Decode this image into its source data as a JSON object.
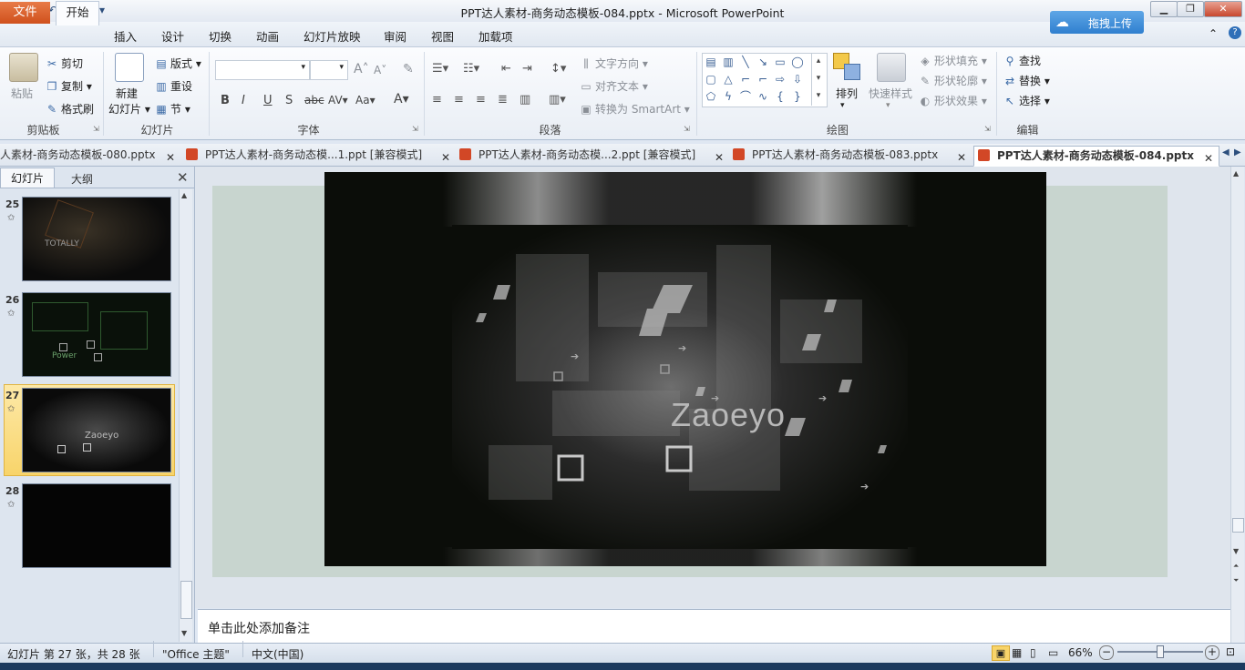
{
  "window": {
    "title": "PPT达人素材-商务动态模板-084.pptx - Microsoft PowerPoint",
    "app_icon": "P",
    "upload_button": "拖拽上传"
  },
  "menu": {
    "file": "文件",
    "tabs": [
      "开始",
      "插入",
      "设计",
      "切换",
      "动画",
      "幻灯片放映",
      "审阅",
      "视图",
      "加载项"
    ]
  },
  "ribbon": {
    "clipboard": {
      "paste": "粘贴",
      "cut": "剪切",
      "copy": "复制",
      "format_painter": "格式刷",
      "label": "剪贴板"
    },
    "slides": {
      "new_slide_line1": "新建",
      "new_slide_line2": "幻灯片",
      "layout": "版式",
      "reset": "重设",
      "section": "节",
      "label": "幻灯片"
    },
    "font": {
      "label": "字体",
      "buttons": [
        "B",
        "I",
        "U",
        "S",
        "abc",
        "AV",
        "Aa",
        "A"
      ],
      "grow": "A",
      "shrink": "A"
    },
    "paragraph": {
      "text_direction": "文字方向",
      "align_text": "对齐文本",
      "smartart": "转换为 SmartArt",
      "label": "段落"
    },
    "drawing": {
      "arrange": "排列",
      "quick_styles": "快速样式",
      "shape_fill": "形状填充",
      "shape_outline": "形状轮廓",
      "shape_effects": "形状效果",
      "label": "绘图"
    },
    "editing": {
      "find": "查找",
      "replace": "替换",
      "select": "选择",
      "label": "编辑"
    }
  },
  "doc_tabs": [
    {
      "label": "人素材-商务动态模板-080.pptx",
      "active": false
    },
    {
      "label": "PPT达人素材-商务动态模...1.ppt [兼容模式]",
      "active": false
    },
    {
      "label": "PPT达人素材-商务动态模...2.ppt [兼容模式]",
      "active": false
    },
    {
      "label": "PPT达人素材-商务动态模板-083.pptx",
      "active": false
    },
    {
      "label": "PPT达人素材-商务动态模板-084.pptx",
      "active": true
    }
  ],
  "left_panel": {
    "tabs": [
      "幻灯片",
      "大纲"
    ],
    "slides": [
      {
        "number": "25",
        "text": "TOTALLY"
      },
      {
        "number": "26",
        "text": "Power"
      },
      {
        "number": "27",
        "text": "Zaoeyo",
        "selected": true
      },
      {
        "number": "28",
        "text": ""
      }
    ]
  },
  "slide": {
    "text": "Zaoeyo"
  },
  "notes": {
    "placeholder": "单击此处添加备注"
  },
  "status": {
    "slide_info": "幻灯片 第 27 张，共 28 张",
    "theme": "\"Office 主题\"",
    "language": "中文(中国)",
    "zoom": "66%",
    "zoom_fraction": 0.5
  },
  "colors": {
    "file_tab": "#d0501c",
    "upload_button": "#2f7fcf",
    "selected_thumb": "#f8d46a"
  }
}
